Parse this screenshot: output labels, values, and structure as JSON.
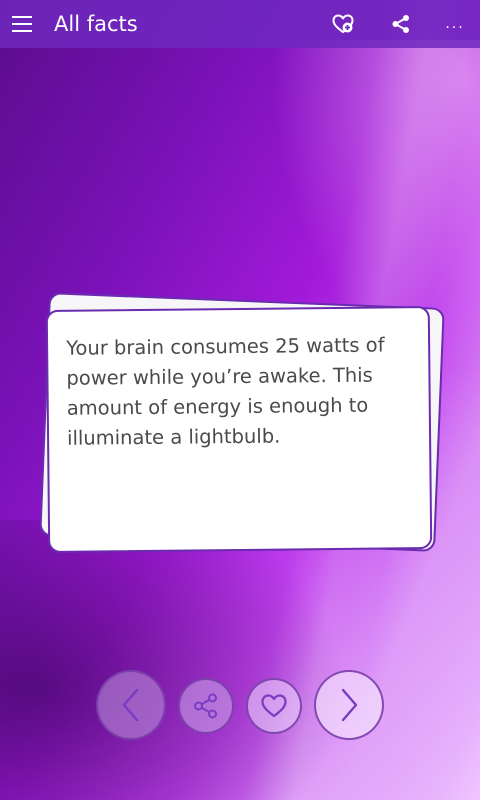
{
  "header": {
    "title": "All facts",
    "menu_icon": "hamburger-icon",
    "add_favorite_icon": "heart-plus-icon",
    "share_icon": "share-icon",
    "more_label": "..."
  },
  "card": {
    "text": "Your brain consumes 25 watts of power while you’re awake. This amount of energy is enough to illuminate a lightbulb."
  },
  "controls": {
    "previous_icon": "chevron-left-icon",
    "share_icon": "share-icon",
    "favorite_icon": "heart-icon",
    "next_icon": "chevron-right-icon"
  },
  "colors": {
    "accent": "#6a2bb0",
    "topbar": "#6e28be",
    "card_background": "#ffffff",
    "card_text": "#4a4a4a"
  }
}
